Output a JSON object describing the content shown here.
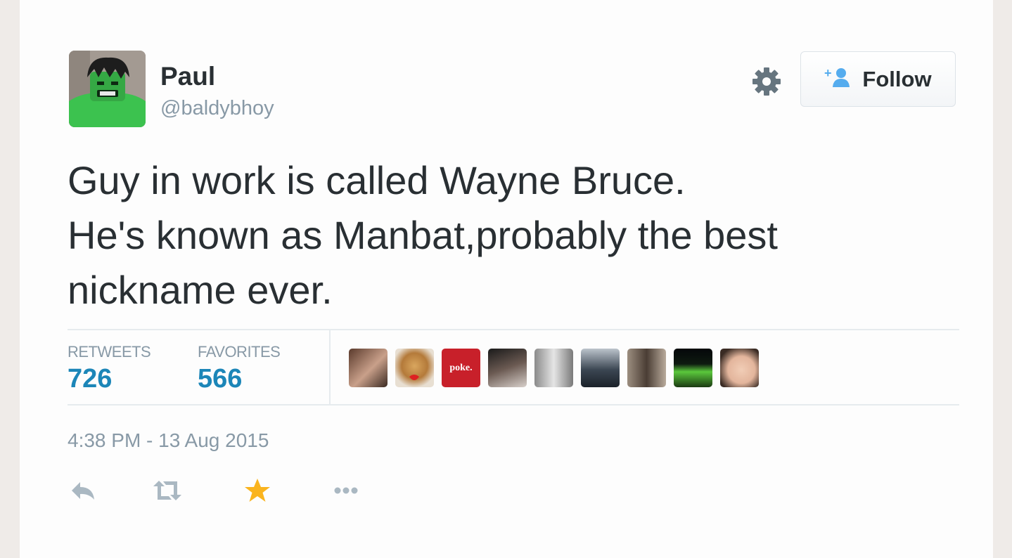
{
  "tweet": {
    "author_name": "Paul",
    "author_handle": "@baldybhoy",
    "text": "Guy in work is called Wayne Bruce.\nHe's known as Manbat,probably the best\nnickname ever.",
    "follow_label": "Follow",
    "timestamp": "4:38 PM - 13 Aug 2015"
  },
  "stats": {
    "retweets_label": "RETWEETS",
    "retweets_count": "726",
    "favorites_label": "FAVORITES",
    "favorites_count": "566"
  },
  "favoriter_avatars": [
    {
      "name": "avatar-1",
      "text": ""
    },
    {
      "name": "avatar-2",
      "text": ""
    },
    {
      "name": "avatar-3",
      "text": "poke."
    },
    {
      "name": "avatar-4",
      "text": ""
    },
    {
      "name": "avatar-5",
      "text": ""
    },
    {
      "name": "avatar-6",
      "text": ""
    },
    {
      "name": "avatar-7",
      "text": ""
    },
    {
      "name": "avatar-8",
      "text": ""
    },
    {
      "name": "avatar-9",
      "text": ""
    }
  ],
  "icons": {
    "settings": "gear-icon",
    "follow": "add-user-icon",
    "reply": "reply-icon",
    "retweet": "retweet-icon",
    "favorite": "star-icon",
    "more": "more-icon"
  },
  "colors": {
    "count_blue": "#1c86b8",
    "favorite_active": "#fab41e",
    "muted": "#8899a6"
  }
}
